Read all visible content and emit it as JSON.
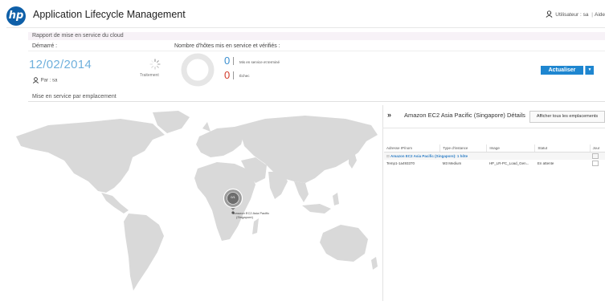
{
  "header": {
    "logo_text": "hp",
    "app_title": "Application Lifecycle Management",
    "user_label": "Utilisateur : sa",
    "help_label": "Aide"
  },
  "report": {
    "section_title": "Rapport de mise en service du cloud",
    "started_label": "Démarré :",
    "started_date": "12/02/2014",
    "by_label": "Par : sa",
    "hosts_label": "Nombre d'hôtes mis en service et vérifiés :",
    "processing_label": "Traitement",
    "done_count": "0",
    "done_label": "Mis en service et terminé",
    "failed_count": "0",
    "failed_label": "Échec",
    "refresh_label": "Actualiser",
    "refresh_dropdown": "▼"
  },
  "locations": {
    "section_title": "Mise en service par emplacement",
    "pin_count": "0/1",
    "pin_label_line1": "Amazon EC2 Asia Pacific",
    "pin_label_line2": "(Singapore)"
  },
  "details": {
    "collapse_icon": "»",
    "title": "Amazon EC2 Asia Pacific (Singapore) Détails",
    "show_all_label": "Afficher tous les emplacements",
    "columns": [
      "Adresse IP/nom",
      "Type d'instance",
      "Image",
      "Statut",
      "Jour"
    ],
    "group_label": "Amazon EC2 Asia Pacific (Singapore): 1 hôte",
    "rows": [
      {
        "ip": "Temp1-1a493370",
        "type": "M3 Medium",
        "image": "HP_LR-PC_Load_Gen...",
        "status": "En attente"
      }
    ]
  },
  "colors": {
    "brand": "#0e5fa8",
    "accent": "#1e86d0",
    "done": "#3b8fd0",
    "failed": "#d23b2b",
    "date": "#6fb0dc"
  }
}
